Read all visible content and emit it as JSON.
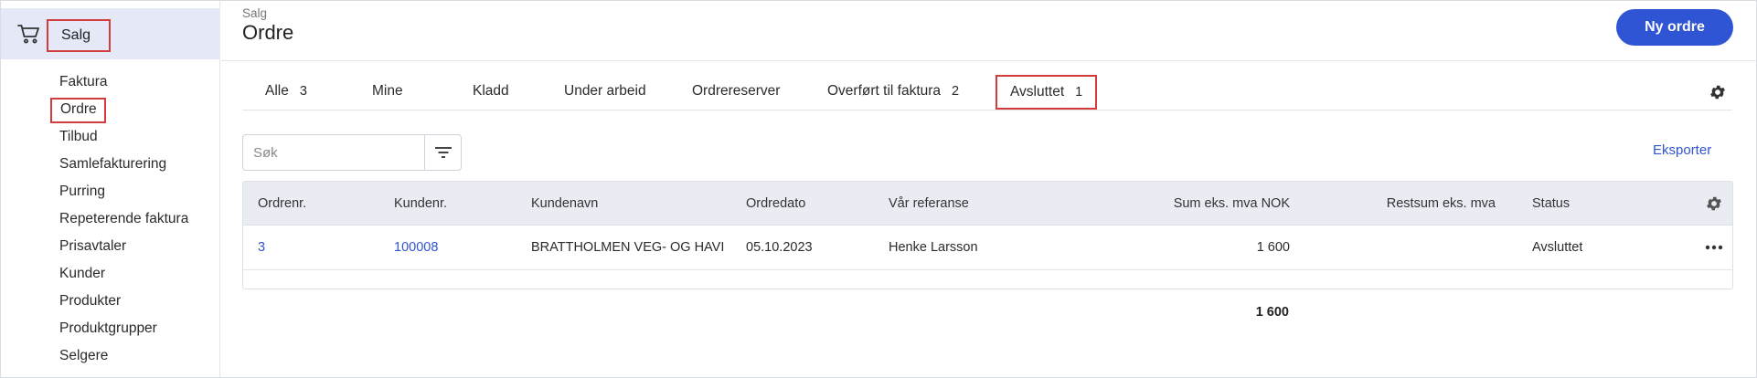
{
  "sidebar": {
    "title": "Salg",
    "icon": "cart-icon",
    "items": [
      {
        "label": "Faktura"
      },
      {
        "label": "Ordre",
        "active": true
      },
      {
        "label": "Tilbud"
      },
      {
        "label": "Samlefakturering"
      },
      {
        "label": "Purring"
      },
      {
        "label": "Repeterende faktura"
      },
      {
        "label": "Prisavtaler"
      },
      {
        "label": "Kunder"
      },
      {
        "label": "Produkter"
      },
      {
        "label": "Produktgrupper"
      },
      {
        "label": "Selgere"
      }
    ]
  },
  "header": {
    "breadcrumb": "Salg",
    "title": "Ordre",
    "new_order_label": "Ny ordre"
  },
  "tabs": [
    {
      "label": "Alle",
      "count": "3"
    },
    {
      "label": "Mine",
      "count": ""
    },
    {
      "label": "Kladd",
      "count": ""
    },
    {
      "label": "Under arbeid",
      "count": ""
    },
    {
      "label": "Ordrereserver",
      "count": ""
    },
    {
      "label": "Overført til faktura",
      "count": "2"
    },
    {
      "label": "Avsluttet",
      "count": "1",
      "active": true
    }
  ],
  "search": {
    "placeholder": "Søk",
    "value": ""
  },
  "export_label": "Eksporter",
  "table": {
    "columns": [
      "Ordrenr.",
      "Kundenr.",
      "Kundenavn",
      "Ordredato",
      "Vår referanse",
      "Sum eks. mva NOK",
      "Restsum eks. mva",
      "Status"
    ],
    "rows": [
      {
        "ordrenr": "3",
        "kundenr": "100008",
        "kundenavn": "BRATTHOLMEN VEG- OG HAVI",
        "ordredato": "05.10.2023",
        "referanse": "Henke Larsson",
        "sum": "1 600",
        "restsum": "",
        "status": "Avsluttet"
      }
    ],
    "total": "1 600"
  },
  "colors": {
    "accent": "#2f55d4",
    "highlight": "#d23c3c",
    "sidebar_header_bg": "#e4e8f7",
    "table_head_bg": "#e9ecf3"
  }
}
